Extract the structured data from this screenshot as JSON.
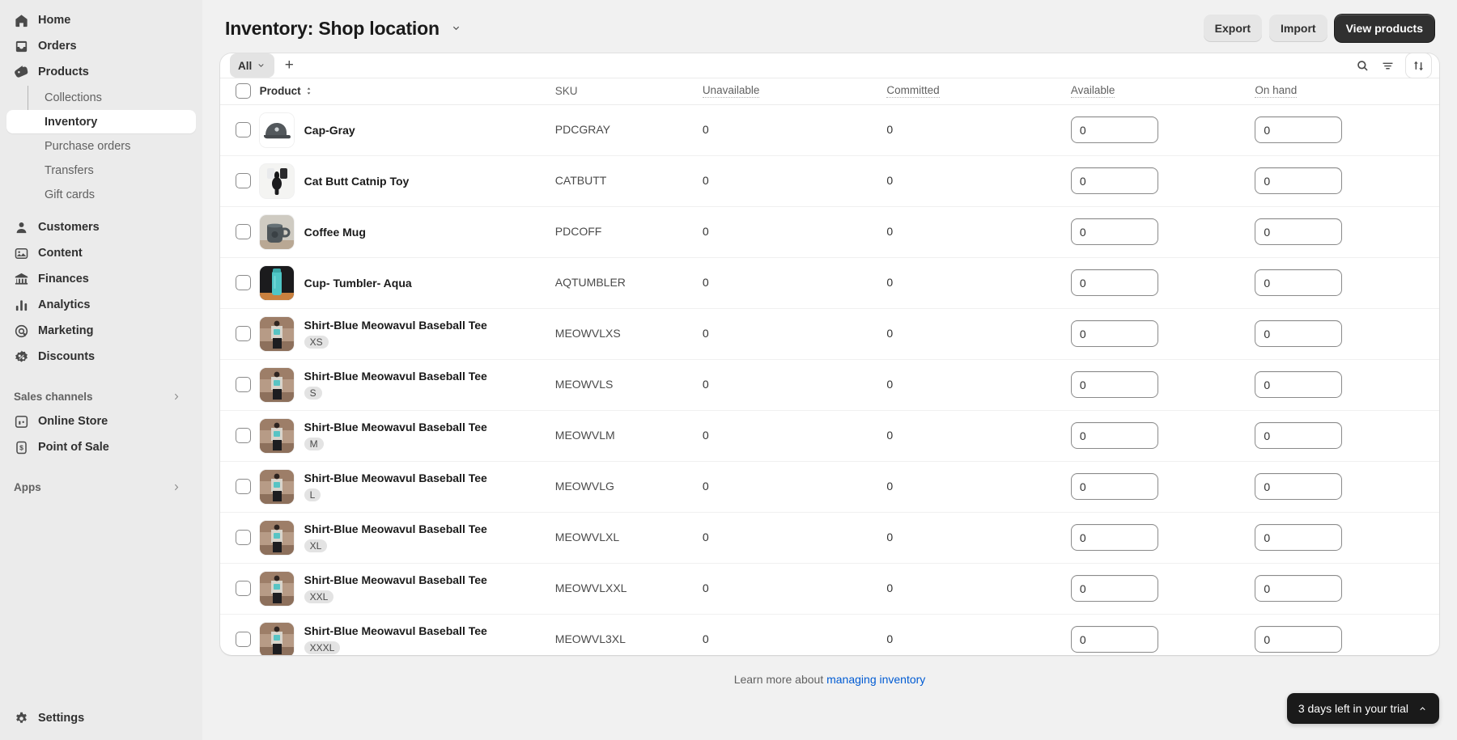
{
  "sidebar": {
    "items": [
      {
        "label": "Home",
        "icon": "home-icon"
      },
      {
        "label": "Orders",
        "icon": "orders-icon"
      },
      {
        "label": "Products",
        "icon": "products-tag-icon"
      }
    ],
    "product_subitems": [
      {
        "label": "Collections",
        "active": false
      },
      {
        "label": "Inventory",
        "active": true
      },
      {
        "label": "Purchase orders",
        "active": false
      },
      {
        "label": "Transfers",
        "active": false
      },
      {
        "label": "Gift cards",
        "active": false
      }
    ],
    "items2": [
      {
        "label": "Customers",
        "icon": "customers-icon"
      },
      {
        "label": "Content",
        "icon": "content-icon"
      },
      {
        "label": "Finances",
        "icon": "finances-bank-icon"
      },
      {
        "label": "Analytics",
        "icon": "analytics-bars-icon"
      },
      {
        "label": "Marketing",
        "icon": "marketing-target-icon"
      },
      {
        "label": "Discounts",
        "icon": "discounts-badge-icon"
      }
    ],
    "sales_channels_label": "Sales channels",
    "channels": [
      {
        "label": "Online Store",
        "icon": "store-icon"
      },
      {
        "label": "Point of Sale",
        "icon": "pos-icon"
      }
    ],
    "apps_label": "Apps",
    "settings_label": "Settings"
  },
  "header": {
    "title": "Inventory: Shop location",
    "export_label": "Export",
    "import_label": "Import",
    "view_products_label": "View products"
  },
  "table_toolbar": {
    "tab_all_label": "All",
    "add_tab_label": "+"
  },
  "columns": {
    "product": "Product",
    "sku": "SKU",
    "unavailable": "Unavailable",
    "committed": "Committed",
    "available": "Available",
    "on_hand": "On hand"
  },
  "rows": [
    {
      "name": "Cap-Gray",
      "variant": "",
      "sku": "PDCGRAY",
      "unavailable": "0",
      "committed": "0",
      "available": "0",
      "on_hand": "0",
      "thumb": "cap-gray"
    },
    {
      "name": "Cat Butt Catnip Toy",
      "variant": "",
      "sku": "CATBUTT",
      "unavailable": "0",
      "committed": "0",
      "available": "0",
      "on_hand": "0",
      "thumb": "catnip-toy"
    },
    {
      "name": "Coffee Mug",
      "variant": "",
      "sku": "PDCOFF",
      "unavailable": "0",
      "committed": "0",
      "available": "0",
      "on_hand": "0",
      "thumb": "coffee-mug"
    },
    {
      "name": "Cup- Tumbler- Aqua",
      "variant": "",
      "sku": "AQTUMBLER",
      "unavailable": "0",
      "committed": "0",
      "available": "0",
      "on_hand": "0",
      "thumb": "tumbler-aqua"
    },
    {
      "name": "Shirt-Blue Meowavul Baseball Tee",
      "variant": "XS",
      "sku": "MEOWVLXS",
      "unavailable": "0",
      "committed": "0",
      "available": "0",
      "on_hand": "0",
      "thumb": "shirt-blue"
    },
    {
      "name": "Shirt-Blue Meowavul Baseball Tee",
      "variant": "S",
      "sku": "MEOWVLS",
      "unavailable": "0",
      "committed": "0",
      "available": "0",
      "on_hand": "0",
      "thumb": "shirt-blue"
    },
    {
      "name": "Shirt-Blue Meowavul Baseball Tee",
      "variant": "M",
      "sku": "MEOWVLM",
      "unavailable": "0",
      "committed": "0",
      "available": "0",
      "on_hand": "0",
      "thumb": "shirt-blue"
    },
    {
      "name": "Shirt-Blue Meowavul Baseball Tee",
      "variant": "L",
      "sku": "MEOWVLG",
      "unavailable": "0",
      "committed": "0",
      "available": "0",
      "on_hand": "0",
      "thumb": "shirt-blue"
    },
    {
      "name": "Shirt-Blue Meowavul Baseball Tee",
      "variant": "XL",
      "sku": "MEOWVLXL",
      "unavailable": "0",
      "committed": "0",
      "available": "0",
      "on_hand": "0",
      "thumb": "shirt-blue"
    },
    {
      "name": "Shirt-Blue Meowavul Baseball Tee",
      "variant": "XXL",
      "sku": "MEOWVLXXL",
      "unavailable": "0",
      "committed": "0",
      "available": "0",
      "on_hand": "0",
      "thumb": "shirt-blue"
    },
    {
      "name": "Shirt-Blue Meowavul Baseball Tee",
      "variant": "XXXL",
      "sku": "MEOWVL3XL",
      "unavailable": "0",
      "committed": "0",
      "available": "0",
      "on_hand": "0",
      "thumb": "shirt-blue"
    }
  ],
  "footer": {
    "text_prefix": "Learn more about ",
    "link_label": "managing inventory"
  },
  "trial": {
    "label": "3 days left in your trial"
  },
  "colors": {
    "accent_link": "#005bd3",
    "sidebar_bg": "#ebebeb",
    "page_bg": "#f1f1f1",
    "primary_button": "#303030",
    "trial_bg": "#1a1a1a"
  }
}
